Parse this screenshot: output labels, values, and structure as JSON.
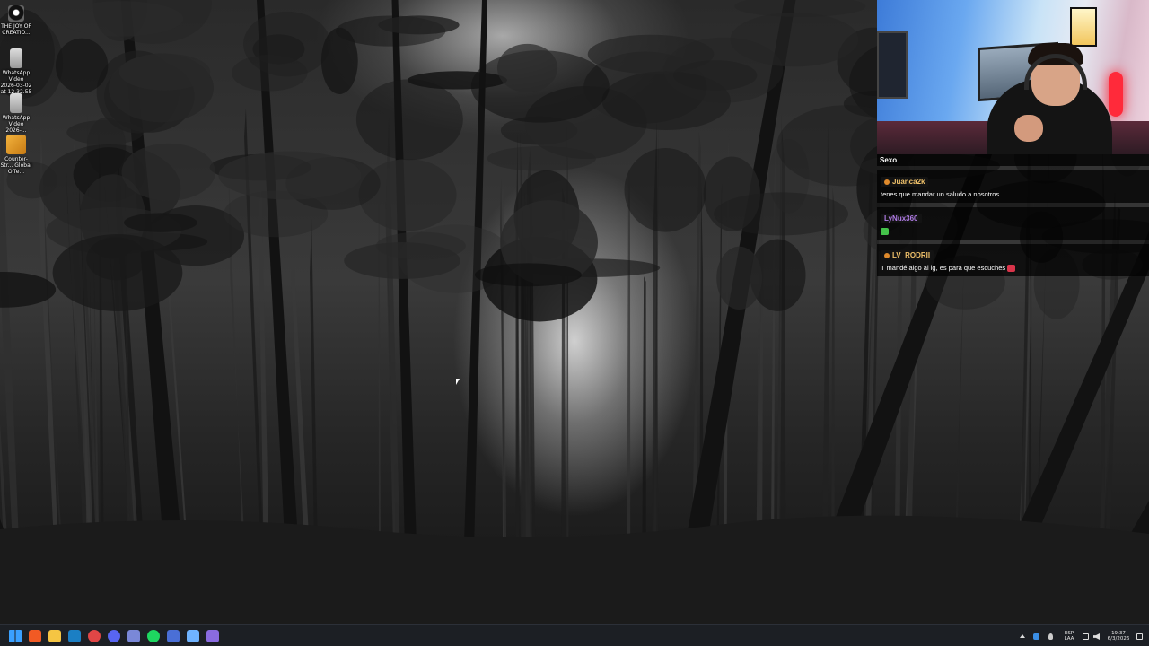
{
  "desktop": {
    "icons": [
      {
        "label": "THE JOY OF CREATIO...",
        "icon": "joy-of-creation-icon"
      },
      {
        "label": "WhatsApp Video 2026-03-02 at 12.32.55",
        "icon": "video-file-icon"
      },
      {
        "label": "WhatsApp Video 2026-...",
        "icon": "video-file-icon"
      },
      {
        "label": "Counter-Str... Global Offe...",
        "icon": "csgo-icon"
      }
    ]
  },
  "stream": {
    "chat_title": "Sexo",
    "messages": [
      {
        "user": "Juanca2k",
        "user_color": "#f2c36b",
        "text": "tenes que mandar un saludo a nosotros",
        "badge": true
      },
      {
        "user": "LyNux360",
        "user_color": "#b07be6",
        "text": "",
        "emote_color": "#44c24a",
        "badge": false
      },
      {
        "user": "LV_RODRII",
        "user_color": "#f2c36b",
        "text": "T mandé algo al ig, es para que escuches",
        "emote_color": "#d9344a",
        "badge": true
      }
    ]
  },
  "taskbar": {
    "apps": [
      {
        "name": "start-button",
        "color": "#3aa0ff"
      },
      {
        "name": "brave-browser-icon",
        "color": "#f15a24"
      },
      {
        "name": "file-explorer-icon",
        "color": "#f5c543"
      },
      {
        "name": "steam-icon",
        "color": "#1b7fc4"
      },
      {
        "name": "chrome-icon",
        "color": "#e04646"
      },
      {
        "name": "discord-icon",
        "color": "#5865f2"
      },
      {
        "name": "app-window-icon",
        "color": "#7a88d8"
      },
      {
        "name": "spotify-icon",
        "color": "#1ed760"
      },
      {
        "name": "vpn-icon",
        "color": "#4a6fd6"
      },
      {
        "name": "network-tool-icon",
        "color": "#6fb3ff"
      },
      {
        "name": "obs-like-icon",
        "color": "#8a6be0"
      }
    ],
    "language_top": "ESP",
    "language_bottom": "LAA",
    "time": "19:37",
    "date": "6/3/2026"
  }
}
